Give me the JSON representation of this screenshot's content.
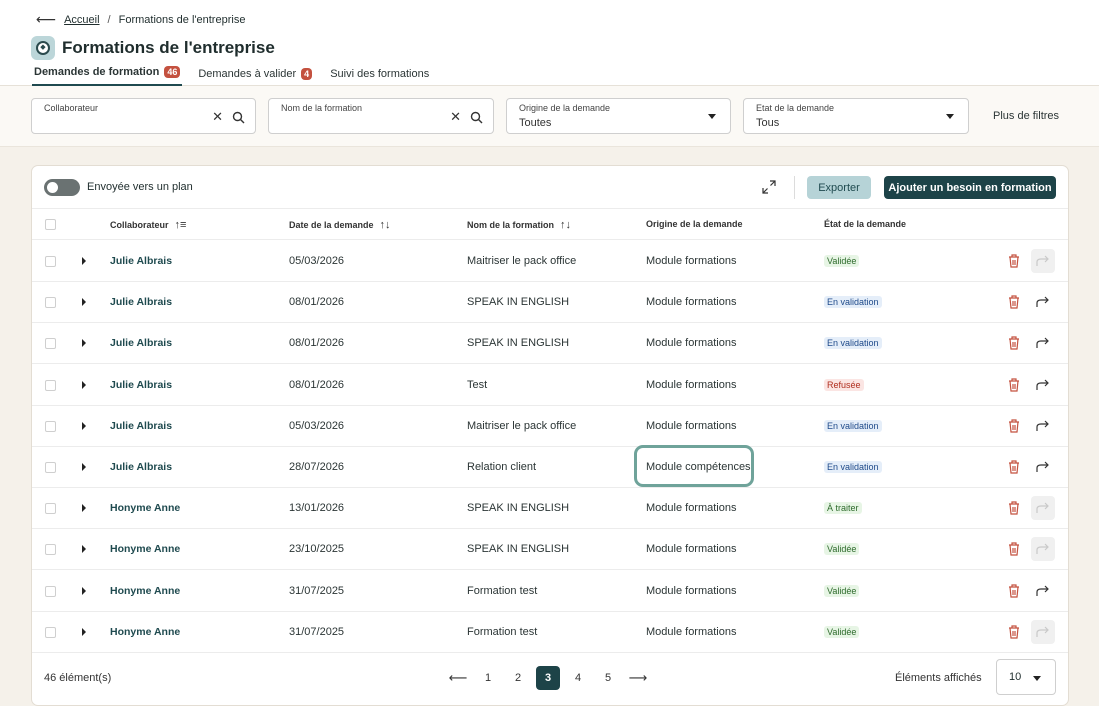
{
  "breadcrumb": {
    "home": "Accueil",
    "current": "Formations de l'entreprise"
  },
  "page": {
    "title": "Formations de l'entreprise"
  },
  "tabs": [
    {
      "label": "Demandes de formation",
      "count": "46",
      "active": true
    },
    {
      "label": "Demandes à valider",
      "count": "4",
      "active": false
    },
    {
      "label": "Suivi des formations",
      "count": "",
      "active": false
    }
  ],
  "filters": {
    "collaborateur": {
      "label": "Collaborateur",
      "value": ""
    },
    "formation": {
      "label": "Nom de la formation",
      "value": ""
    },
    "origine": {
      "label": "Origine de la demande",
      "value": "Toutes"
    },
    "etat": {
      "label": "Etat de la demande",
      "value": "Tous"
    },
    "more": "Plus de filtres"
  },
  "toolbar": {
    "toggle_label": "Envoyée vers un plan",
    "export_label": "Exporter",
    "add_label": "Ajouter un besoin en formation"
  },
  "table": {
    "headers": {
      "collab": "Collaborateur",
      "date": "Date de la demande",
      "formation": "Nom de la formation",
      "origine": "Origine de la demande",
      "etat": "État de la demande"
    },
    "rows": [
      {
        "collab": "Julie Albrais",
        "date": "05/03/2026",
        "formation": "Maitriser le pack office",
        "origine": "Module formations",
        "etat": "Validée",
        "kind": "valid",
        "send": false
      },
      {
        "collab": "Julie Albrais",
        "date": "08/01/2026",
        "formation": "SPEAK IN ENGLISH",
        "origine": "Module formations",
        "etat": "En validation",
        "kind": "pending",
        "send": true
      },
      {
        "collab": "Julie Albrais",
        "date": "08/01/2026",
        "formation": "SPEAK IN ENGLISH",
        "origine": "Module formations",
        "etat": "En validation",
        "kind": "pending",
        "send": true
      },
      {
        "collab": "Julie Albrais",
        "date": "08/01/2026",
        "formation": "Test",
        "origine": "Module formations",
        "etat": "Refusée",
        "kind": "refused",
        "send": true
      },
      {
        "collab": "Julie Albrais",
        "date": "05/03/2026",
        "formation": "Maitriser le pack office",
        "origine": "Module formations",
        "etat": "En validation",
        "kind": "pending",
        "send": true
      },
      {
        "collab": "Julie Albrais",
        "date": "28/07/2026",
        "formation": "Relation client",
        "origine": "Module compétences",
        "etat": "En validation",
        "kind": "pending",
        "send": true
      },
      {
        "collab": "Honyme Anne",
        "date": "13/01/2026",
        "formation": "SPEAK IN ENGLISH",
        "origine": "Module formations",
        "etat": "À traiter",
        "kind": "todo",
        "send": false
      },
      {
        "collab": "Honyme Anne",
        "date": "23/10/2025",
        "formation": "SPEAK IN ENGLISH",
        "origine": "Module formations",
        "etat": "Validée",
        "kind": "valid",
        "send": false
      },
      {
        "collab": "Honyme Anne",
        "date": "31/07/2025",
        "formation": "Formation test",
        "origine": "Module formations",
        "etat": "Validée",
        "kind": "valid",
        "send": true
      },
      {
        "collab": "Honyme Anne",
        "date": "31/07/2025",
        "formation": "Formation test",
        "origine": "Module formations",
        "etat": "Validée",
        "kind": "valid",
        "send": false
      }
    ]
  },
  "footer": {
    "count": "46 élément(s)",
    "pages": [
      "1",
      "2",
      "3",
      "4",
      "5"
    ],
    "current_page": "3",
    "prev": "⟵",
    "next": "⟶",
    "shown_label": "Éléments affichés",
    "page_size": "10"
  },
  "colors": {
    "primary": "#1d4348",
    "accent_light": "#b6d3d7",
    "danger": "#c4513f",
    "highlight": "#6fa39a"
  }
}
